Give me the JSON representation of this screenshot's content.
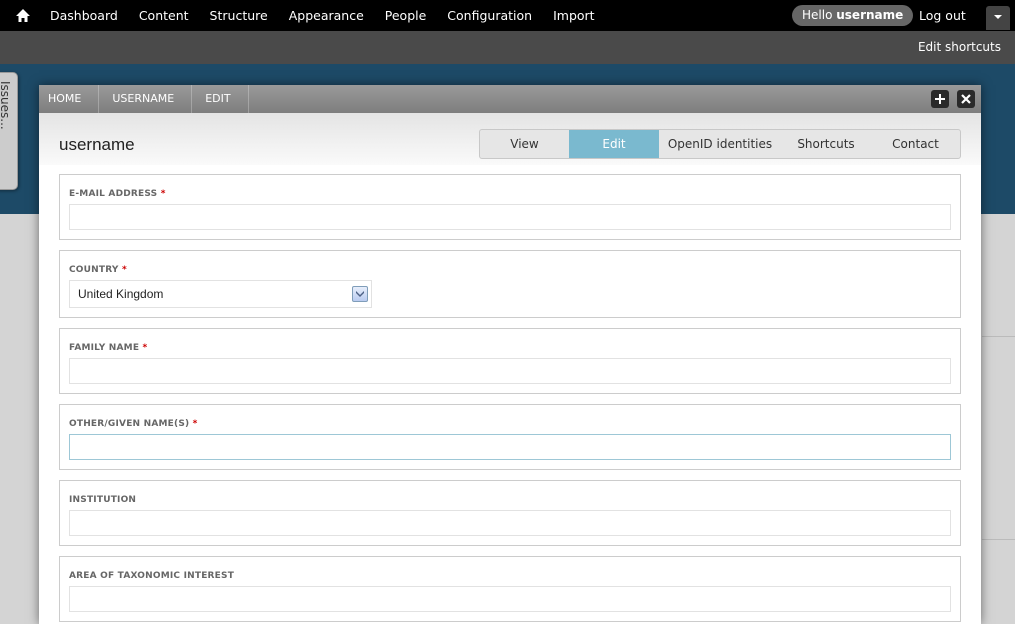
{
  "toolbar": {
    "menu": [
      "Dashboard",
      "Content",
      "Structure",
      "Appearance",
      "People",
      "Configuration",
      "Import"
    ],
    "hello_prefix": "Hello",
    "username": "username",
    "logout": "Log out",
    "edit_shortcuts": "Edit shortcuts"
  },
  "sidebar_tab": {
    "label": "Issues..."
  },
  "overlay": {
    "breadcrumb": [
      "HOME",
      "USERNAME",
      "EDIT"
    ],
    "title": "username",
    "tabs": [
      {
        "label": "View",
        "active": false
      },
      {
        "label": "Edit",
        "active": true
      },
      {
        "label": "OpenID identities",
        "active": false
      },
      {
        "label": "Shortcuts",
        "active": false
      },
      {
        "label": "Contact",
        "active": false
      }
    ]
  },
  "form": {
    "email": {
      "label": "E-MAIL ADDRESS",
      "required": "*",
      "value": ""
    },
    "country": {
      "label": "COUNTRY",
      "required": "*",
      "value": "United Kingdom"
    },
    "family_name": {
      "label": "FAMILY NAME",
      "required": "*",
      "value": ""
    },
    "given_names": {
      "label": "OTHER/GIVEN NAME(S)",
      "required": "*",
      "value": ""
    },
    "institution": {
      "label": "INSTITUTION",
      "value": ""
    },
    "taxonomic_interest": {
      "label": "AREA OF TAXONOMIC INTEREST",
      "value": ""
    }
  },
  "colors": {
    "toolbar_bg": "#000000",
    "active_tab": "#7ab9cf",
    "required_marker": "#cc0000",
    "header_bg": "#1d4a67"
  }
}
